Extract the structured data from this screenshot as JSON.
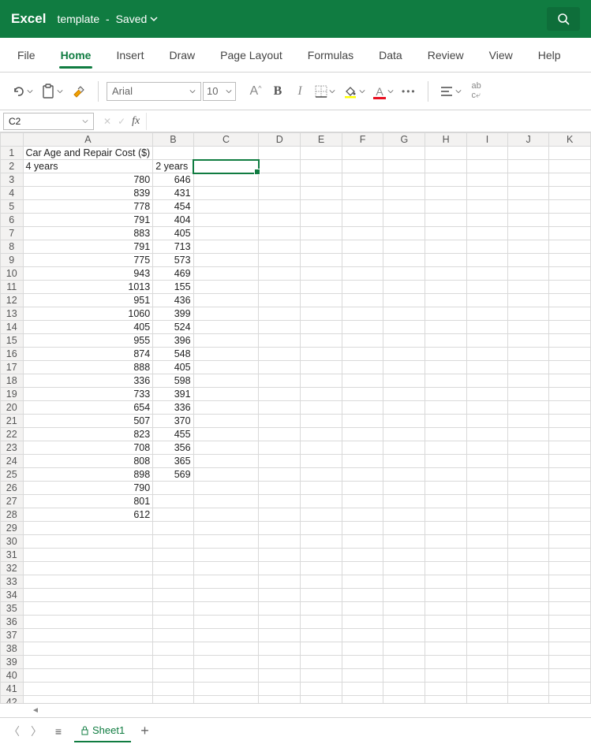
{
  "app": {
    "name": "Excel",
    "document": "template",
    "saveState": "Saved"
  },
  "tabs": [
    "File",
    "Home",
    "Insert",
    "Draw",
    "Page Layout",
    "Formulas",
    "Data",
    "Review",
    "View",
    "Help"
  ],
  "activeTab": "Home",
  "ribbon": {
    "fontName": "Arial",
    "fontSize": "10"
  },
  "nameBox": "C2",
  "formula": "",
  "columns": [
    "A",
    "B",
    "C",
    "D",
    "E",
    "F",
    "G",
    "H",
    "I",
    "J",
    "K"
  ],
  "rowCount": 42,
  "selectedCell": {
    "row": 2,
    "col": "C"
  },
  "sheet": {
    "name": "Sheet1"
  },
  "cells": {
    "A1": {
      "v": "Car Age and Repair Cost ($)",
      "t": "text",
      "overflow": true
    },
    "A2": {
      "v": "4 years",
      "t": "text"
    },
    "B2": {
      "v": "2 years",
      "t": "text"
    },
    "A3": {
      "v": "780"
    },
    "B3": {
      "v": "646"
    },
    "A4": {
      "v": "839"
    },
    "B4": {
      "v": "431"
    },
    "A5": {
      "v": "778"
    },
    "B5": {
      "v": "454"
    },
    "A6": {
      "v": "791"
    },
    "B6": {
      "v": "404"
    },
    "A7": {
      "v": "883"
    },
    "B7": {
      "v": "405"
    },
    "A8": {
      "v": "791"
    },
    "B8": {
      "v": "713"
    },
    "A9": {
      "v": "775"
    },
    "B9": {
      "v": "573"
    },
    "A10": {
      "v": "943"
    },
    "B10": {
      "v": "469"
    },
    "A11": {
      "v": "1013"
    },
    "B11": {
      "v": "155"
    },
    "A12": {
      "v": "951"
    },
    "B12": {
      "v": "436"
    },
    "A13": {
      "v": "1060"
    },
    "B13": {
      "v": "399"
    },
    "A14": {
      "v": "405"
    },
    "B14": {
      "v": "524"
    },
    "A15": {
      "v": "955"
    },
    "B15": {
      "v": "396"
    },
    "A16": {
      "v": "874"
    },
    "B16": {
      "v": "548"
    },
    "A17": {
      "v": "888"
    },
    "B17": {
      "v": "405"
    },
    "A18": {
      "v": "336"
    },
    "B18": {
      "v": "598"
    },
    "A19": {
      "v": "733"
    },
    "B19": {
      "v": "391"
    },
    "A20": {
      "v": "654"
    },
    "B20": {
      "v": "336"
    },
    "A21": {
      "v": "507"
    },
    "B21": {
      "v": "370"
    },
    "A22": {
      "v": "823"
    },
    "B22": {
      "v": "455"
    },
    "A23": {
      "v": "708"
    },
    "B23": {
      "v": "356"
    },
    "A24": {
      "v": "808"
    },
    "B24": {
      "v": "365"
    },
    "A25": {
      "v": "898"
    },
    "B25": {
      "v": "569"
    },
    "A26": {
      "v": "790"
    },
    "A27": {
      "v": "801"
    },
    "A28": {
      "v": "612"
    }
  }
}
